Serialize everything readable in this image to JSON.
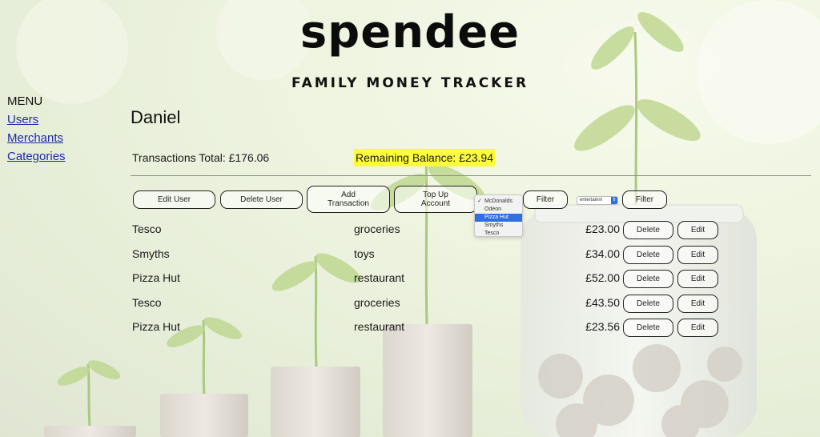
{
  "header": {
    "logo": "spendee",
    "tagline": "FAMILY MONEY TRACKER"
  },
  "menu": {
    "title": "MENU",
    "items": [
      "Users",
      "Merchants",
      "Categories"
    ]
  },
  "user": {
    "name": "Daniel",
    "transactions_total": "Transactions Total: £176.06",
    "remaining_balance": "Remaining Balance: £23.94",
    "balance_highlight": "#fdfd3a"
  },
  "actions": {
    "edit_user": "Edit User",
    "delete_user": "Delete User",
    "add_transaction_line1": "Add",
    "add_transaction_line2": "Transaction",
    "top_up_line1": "Top Up",
    "top_up_line2": "Account",
    "filter1": "Filter",
    "filter2": "Filter"
  },
  "merchant_filter": {
    "options": [
      "McDonalds",
      "Odeon",
      "Pizza Hut",
      "Smyths",
      "Tesco"
    ],
    "checked": "McDonalds",
    "highlighted": "Pizza Hut",
    "highlight_color": "#2f6fe0"
  },
  "category_filter": {
    "selected": "entertainm"
  },
  "transactions": [
    {
      "merchant": "Tesco",
      "category": "groceries",
      "amount": "£23.00",
      "delete": "Delete",
      "edit": "Edit"
    },
    {
      "merchant": "Smyths",
      "category": "toys",
      "amount": "£34.00",
      "delete": "Delete",
      "edit": "Edit"
    },
    {
      "merchant": "Pizza Hut",
      "category": "restaurant",
      "amount": "£52.00",
      "delete": "Delete",
      "edit": "Edit"
    },
    {
      "merchant": "Tesco",
      "category": "groceries",
      "amount": "£43.50",
      "delete": "Delete",
      "edit": "Edit"
    },
    {
      "merchant": "Pizza Hut",
      "category": "restaurant",
      "amount": "£23.56",
      "delete": "Delete",
      "edit": "Edit"
    }
  ]
}
